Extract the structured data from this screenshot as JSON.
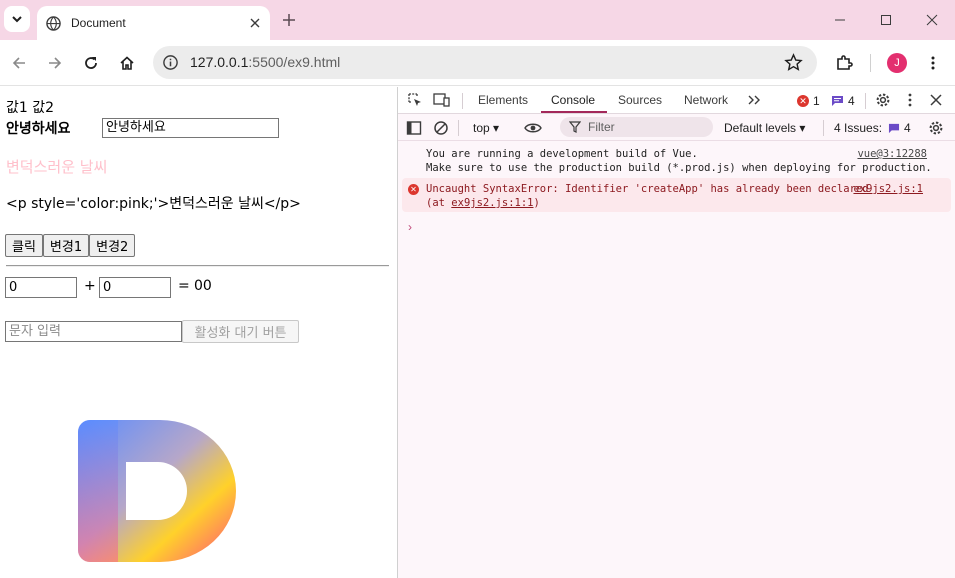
{
  "browser": {
    "tab_title": "Document",
    "url_host": "127.0.0.1",
    "url_rest": ":5500/ex9.html",
    "avatar_letter": "J"
  },
  "page": {
    "line1": "값1 값2",
    "greeting_label": "안녕하세요",
    "greeting_input_value": "안녕하세요",
    "pink_text": "변덕스러운 날씨",
    "raw_html_text": "<p style='color:pink;'>변덕스러운 날씨</p>",
    "buttons": [
      "클릭",
      "변경1",
      "변경2"
    ],
    "num_a": "0",
    "num_b": "0",
    "plus": "+",
    "equals": "=",
    "result": "00",
    "text_input_placeholder": "문자 입력",
    "disabled_button": "활성화 대기 버튼"
  },
  "devtools": {
    "tabs": [
      "Elements",
      "Console",
      "Sources",
      "Network"
    ],
    "active_tab": "Console",
    "error_count": "1",
    "message_count": "4",
    "context": "top",
    "filter_placeholder": "Filter",
    "levels": "Default levels",
    "issues_label": "4 Issues:",
    "issues_count": "4",
    "messages": [
      {
        "type": "info",
        "line1": "You are running a development build of Vue.",
        "line2": "Make sure to use the production build (*.prod.js) when deploying for production.",
        "source": "vue@3:12288"
      },
      {
        "type": "error",
        "line1": "Uncaught SyntaxError: Identifier 'createApp' has already been declared",
        "line2_prefix": "(at ",
        "line2_link": "ex9js2.js:1:1",
        "line2_suffix": ")",
        "source": "ex9js2.js:1"
      }
    ],
    "prompt": "›"
  },
  "colors": {
    "tabstrip": "#f6d7e6",
    "accent": "#a3285a",
    "pink_text": "pink",
    "error_red": "#dc362e"
  }
}
